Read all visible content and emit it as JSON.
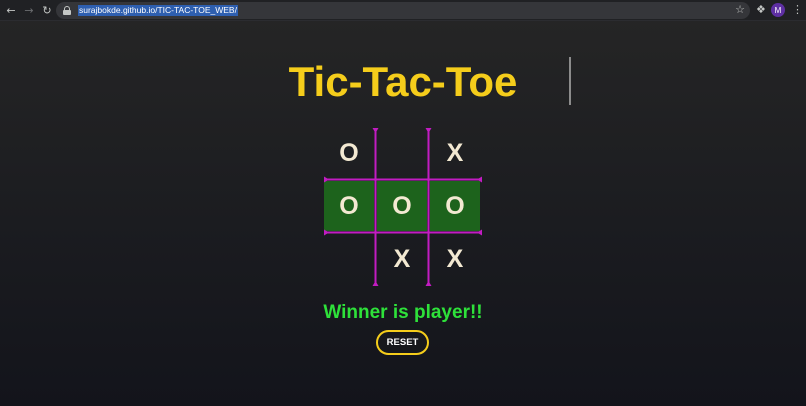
{
  "browser": {
    "url": "surajbokde.github.io/TIC-TAC-TOE_WEB/",
    "avatar_initial": "M",
    "icons": {
      "back": "arrow-left-icon",
      "forward": "arrow-right-icon",
      "reload": "reload-icon",
      "lock": "lock-icon",
      "bookmark": "star-icon",
      "extensions": "puzzle-icon",
      "menu": "kebab-menu-icon"
    }
  },
  "page": {
    "title": "Tic-Tac-Toe",
    "board": {
      "cells": [
        "O",
        "",
        "X",
        "O",
        "O",
        "O",
        "",
        "X",
        "X"
      ],
      "winning_row": 1
    },
    "winner_message": "Winner is player!!",
    "reset_label": "RESET"
  },
  "colors": {
    "title": "#f5cd1b",
    "grid_lines": "#c21cc2",
    "winning_cells": "#1d631c",
    "winner_text": "#2ee13a",
    "reset_border": "#f5cd1b"
  }
}
